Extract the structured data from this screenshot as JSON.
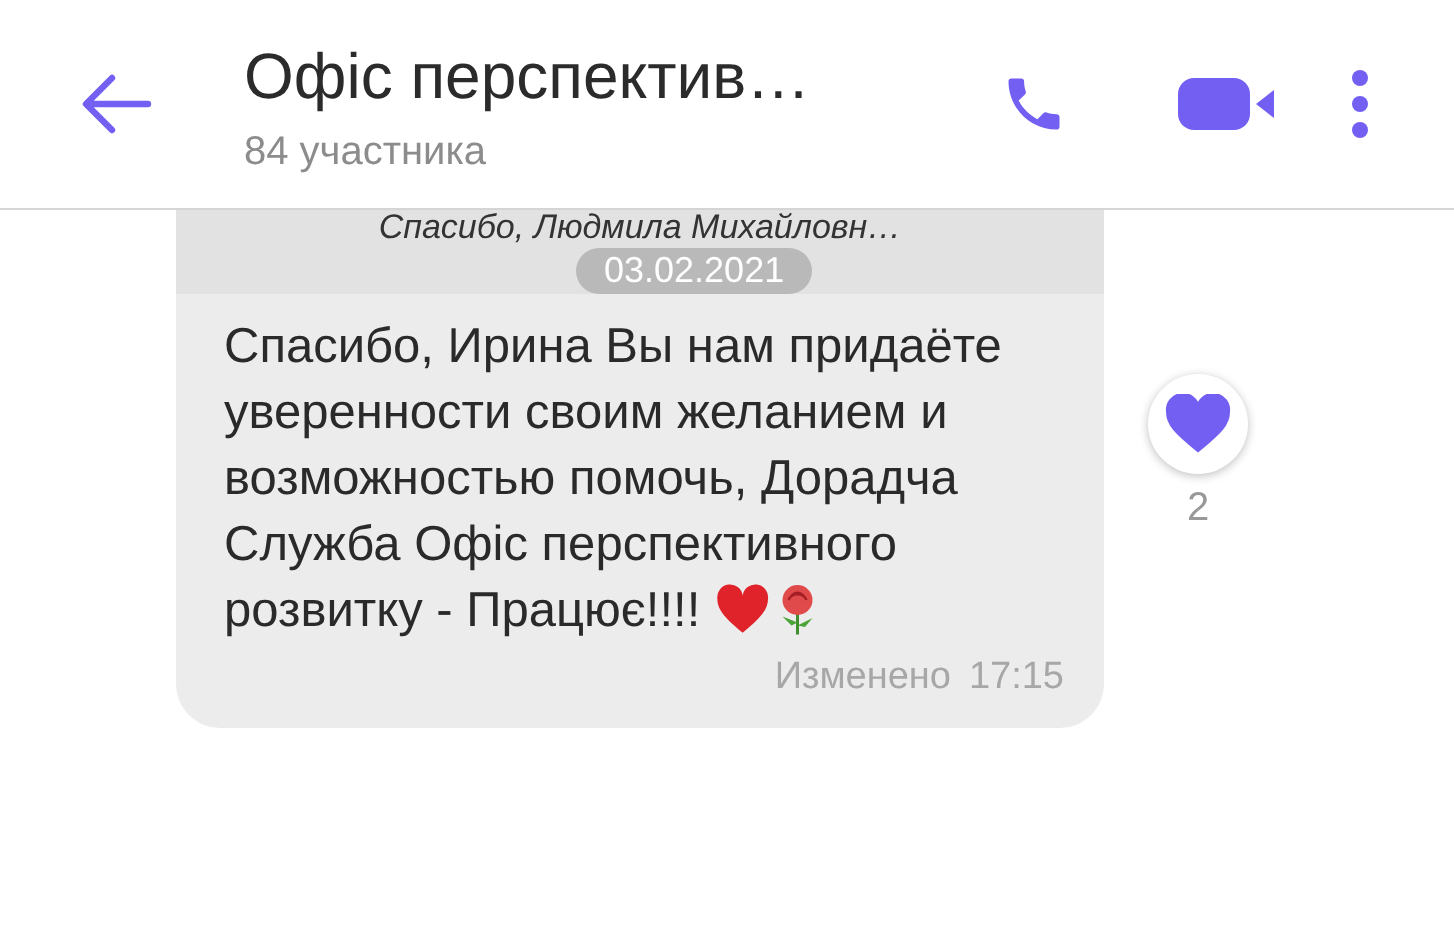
{
  "header": {
    "title": "Офіс перспектив…",
    "subtitle": "84 участника"
  },
  "message": {
    "quote": "Спасибо, Людмила Михайловн…",
    "date": "03.02.2021",
    "text": "Спасибо, Ирина Вы нам придаёте уверенности своим желанием и возможностью помочь, Дорадча Служба Офіс перспективного розвитку - Працює!!!!",
    "edited": "Изменено",
    "time": "17:15",
    "reaction": {
      "liked": true,
      "count": "2"
    }
  }
}
